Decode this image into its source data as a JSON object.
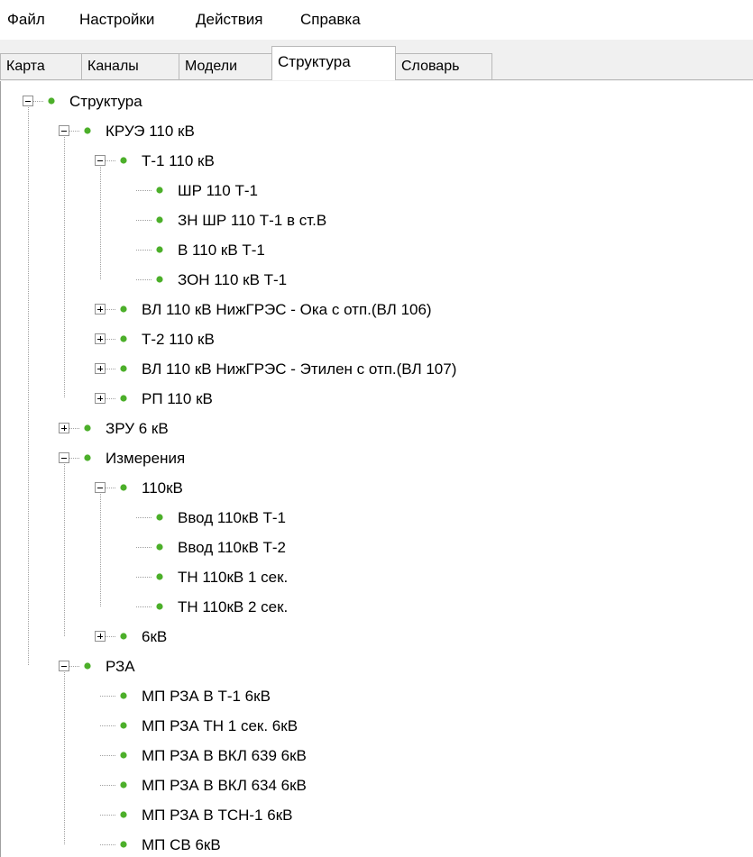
{
  "menu": {
    "items": [
      {
        "id": "file",
        "label": "Файл"
      },
      {
        "id": "settings",
        "label": "Настройки"
      },
      {
        "id": "actions",
        "label": "Действия"
      },
      {
        "id": "help",
        "label": "Справка"
      }
    ]
  },
  "tabs": {
    "items": [
      {
        "id": "map",
        "label": "Карта"
      },
      {
        "id": "channels",
        "label": "Каналы"
      },
      {
        "id": "models",
        "label": "Модели"
      },
      {
        "id": "structure",
        "label": "Структура",
        "active": true
      },
      {
        "id": "dictionary",
        "label": "Словарь"
      }
    ]
  },
  "tree": {
    "nodes": [
      {
        "label": "Структура",
        "depth": 0,
        "expander": "minus"
      },
      {
        "label": "КРУЭ 110 кВ",
        "depth": 1,
        "expander": "minus"
      },
      {
        "label": "Т-1 110 кВ",
        "depth": 2,
        "expander": "minus"
      },
      {
        "label": "ШР 110 Т-1",
        "depth": 3,
        "expander": "none"
      },
      {
        "label": "ЗН ШР 110 Т-1 в ст.В",
        "depth": 3,
        "expander": "none"
      },
      {
        "label": "В 110 кВ Т-1",
        "depth": 3,
        "expander": "none"
      },
      {
        "label": "ЗОН 110 кВ Т-1",
        "depth": 3,
        "expander": "none"
      },
      {
        "label": "ВЛ 110 кВ НижГРЭС - Ока с отп.(ВЛ 106)",
        "depth": 2,
        "expander": "plus"
      },
      {
        "label": "Т-2 110 кВ",
        "depth": 2,
        "expander": "plus"
      },
      {
        "label": "ВЛ 110 кВ НижГРЭС - Этилен с отп.(ВЛ 107)",
        "depth": 2,
        "expander": "plus"
      },
      {
        "label": "РП 110 кВ",
        "depth": 2,
        "expander": "plus"
      },
      {
        "label": "ЗРУ 6 кВ",
        "depth": 1,
        "expander": "plus"
      },
      {
        "label": "Измерения",
        "depth": 1,
        "expander": "minus"
      },
      {
        "label": "110кВ",
        "depth": 2,
        "expander": "minus"
      },
      {
        "label": "Ввод 110кВ Т-1",
        "depth": 3,
        "expander": "none"
      },
      {
        "label": "Ввод 110кВ Т-2",
        "depth": 3,
        "expander": "none"
      },
      {
        "label": "ТН 110кВ 1 сек.",
        "depth": 3,
        "expander": "none"
      },
      {
        "label": "ТН 110кВ 2 сек.",
        "depth": 3,
        "expander": "none"
      },
      {
        "label": "6кВ",
        "depth": 2,
        "expander": "plus"
      },
      {
        "label": "РЗА",
        "depth": 1,
        "expander": "minus"
      },
      {
        "label": "МП РЗА В Т-1 6кВ",
        "depth": 2,
        "expander": "none"
      },
      {
        "label": "МП РЗА ТН 1 сек. 6кВ",
        "depth": 2,
        "expander": "none"
      },
      {
        "label": "МП РЗА В ВКЛ 639 6кВ",
        "depth": 2,
        "expander": "none"
      },
      {
        "label": "МП РЗА В ВКЛ 634 6кВ",
        "depth": 2,
        "expander": "none"
      },
      {
        "label": "МП РЗА В ТСН-1 6кВ",
        "depth": 2,
        "expander": "none"
      },
      {
        "label": "МП СВ 6кВ",
        "depth": 2,
        "expander": "none"
      }
    ]
  },
  "colors": {
    "node_bullet": "#4caf2a",
    "tree_line": "#a0a0a0",
    "expander_border": "#919191"
  }
}
